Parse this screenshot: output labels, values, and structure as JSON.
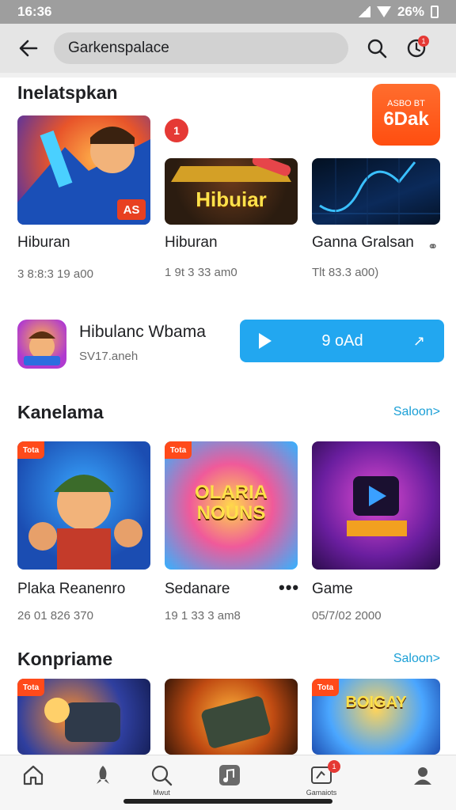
{
  "status_bar": {
    "time": "16:36",
    "battery": "26%"
  },
  "top_bar": {
    "search_value": "Garkenspalace"
  },
  "promo": {
    "small_text": "ASBO BT",
    "big_text": "6Dak"
  },
  "badge_count": "1",
  "sections": [
    {
      "title": "Inelatspkan",
      "items": [
        {
          "title": "Hiburan",
          "subtitle": "3 8:8:3 19 a00",
          "thumb_label": "",
          "tag": "AS"
        },
        {
          "title": "Hiburan",
          "subtitle": "1 9t 3 33 am0",
          "thumb_label": "Hibuiar",
          "tag": ""
        },
        {
          "title": "Ganna Gralsan",
          "subtitle": "Tlt 83.3 a00)",
          "thumb_label": "",
          "tag": ""
        }
      ]
    },
    {
      "title": "Kanelama",
      "see_more": "Saloon>",
      "items": [
        {
          "title": "Plaka Reanenro",
          "subtitle": "26 01 826 370",
          "thumb_label": "",
          "tag": "Tota"
        },
        {
          "title": "Sedanare",
          "subtitle": "19 1 33 3 am8",
          "thumb_label": "OLARIA NOUNS",
          "tag": "Tota"
        },
        {
          "title": "Game",
          "subtitle": "05/7/02 2000",
          "thumb_label": "",
          "tag": ""
        }
      ]
    },
    {
      "title": "Konpriame",
      "see_more": "Saloon>",
      "items": [
        {
          "title": "",
          "subtitle": "",
          "thumb_label": "",
          "tag": "Tota"
        },
        {
          "title": "",
          "subtitle": "",
          "thumb_label": "",
          "tag": ""
        },
        {
          "title": "",
          "subtitle": "",
          "thumb_label": "BOIGAY",
          "tag": "Tota"
        }
      ]
    }
  ],
  "featured": {
    "title": "Hibulanc Wbama",
    "subtitle": "SV17.aneh",
    "button_label": "9 oAd"
  },
  "nav": {
    "items": [
      {
        "label": "",
        "icon": "home-icon"
      },
      {
        "label": "",
        "icon": "rocket-icon"
      },
      {
        "label": "Mwut",
        "icon": "search-icon"
      },
      {
        "label": "",
        "icon": "music-icon"
      },
      {
        "label": "Gamaiots",
        "icon": "games-icon",
        "badge": "1"
      },
      {
        "label": "",
        "icon": "person-icon"
      }
    ]
  }
}
